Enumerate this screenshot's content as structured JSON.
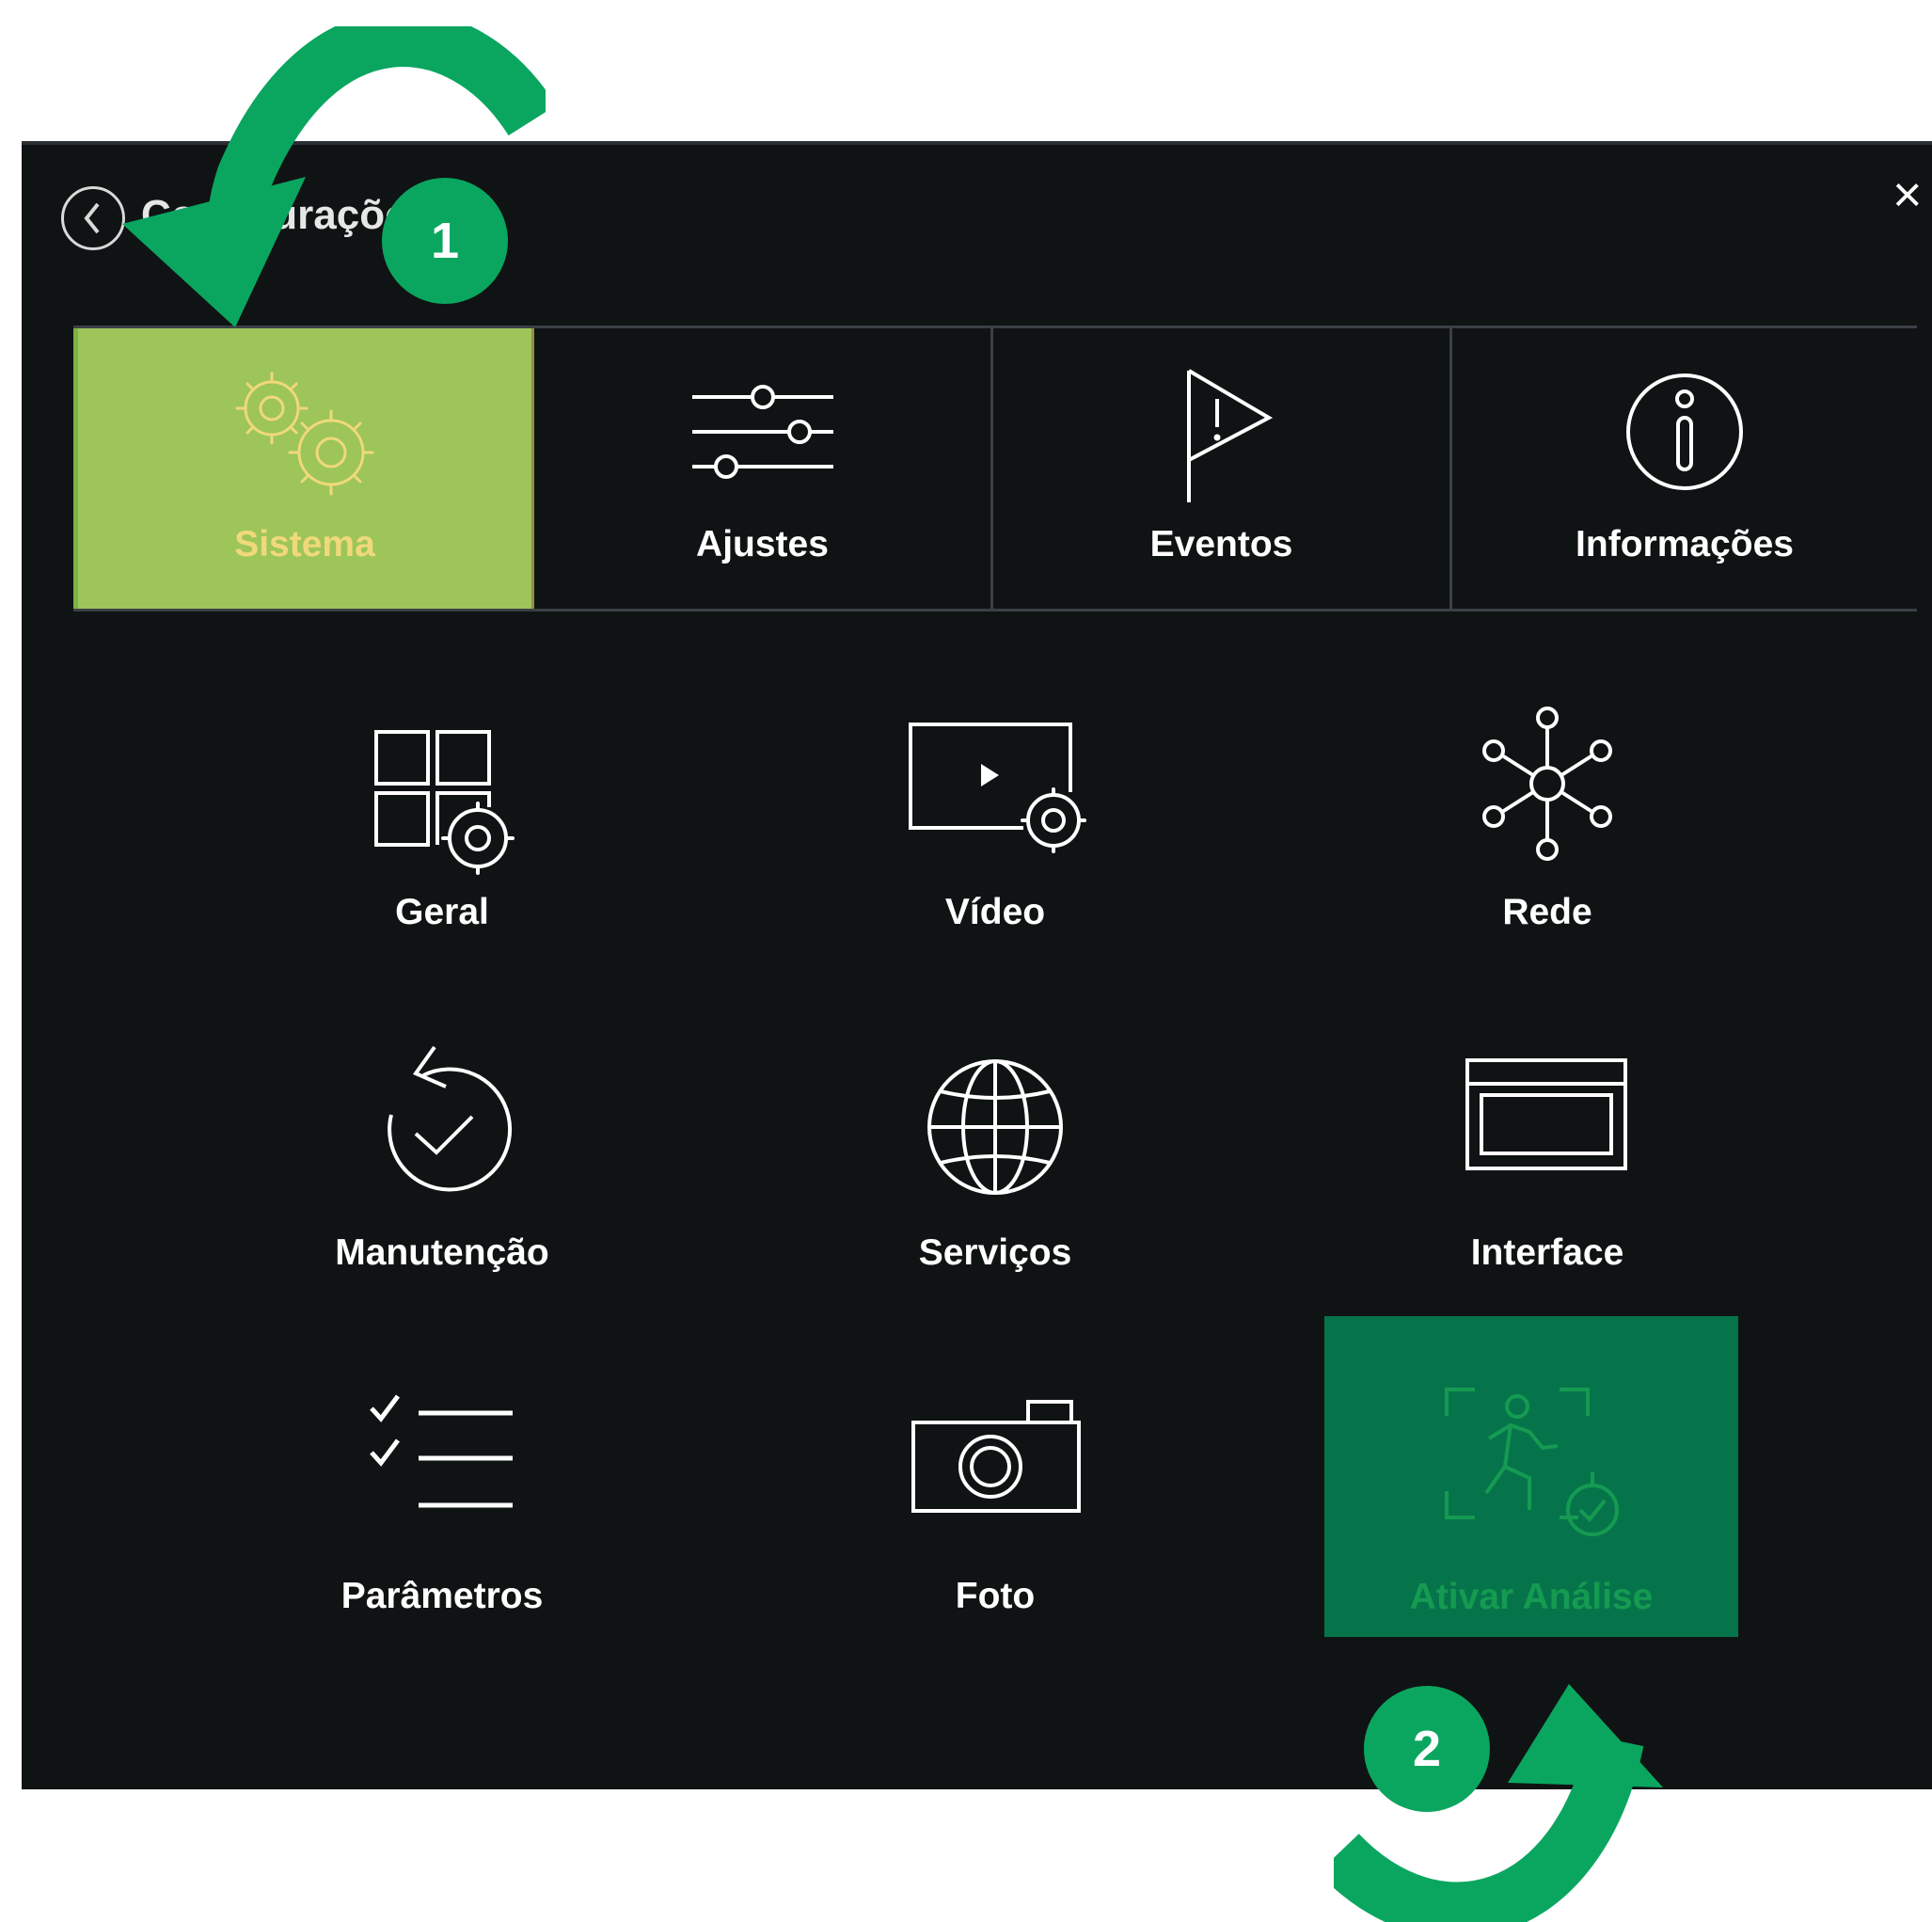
{
  "window": {
    "title": "Configurações",
    "close_label": "×"
  },
  "tabs": [
    {
      "label": "Sistema",
      "icon": "gears-icon",
      "active": true
    },
    {
      "label": "Ajustes",
      "icon": "sliders-icon",
      "active": false
    },
    {
      "label": "Eventos",
      "icon": "flag-alert-icon",
      "active": false
    },
    {
      "label": "Informações",
      "icon": "info-icon",
      "active": false
    }
  ],
  "grid": [
    {
      "label": "Geral",
      "icon": "grid-gear-icon"
    },
    {
      "label": "Vídeo",
      "icon": "video-gear-icon"
    },
    {
      "label": "Rede",
      "icon": "network-icon"
    },
    {
      "label": "Manutenção",
      "icon": "restore-check-icon"
    },
    {
      "label": "Serviços",
      "icon": "globe-icon"
    },
    {
      "label": "Interface",
      "icon": "window-icon"
    },
    {
      "label": "Parâmetros",
      "icon": "checklist-icon"
    },
    {
      "label": "Foto",
      "icon": "camera-icon"
    },
    {
      "label": "Ativar Análise",
      "icon": "person-detect-icon",
      "highlighted": true
    }
  ],
  "annotations": {
    "step1": "1",
    "step2": "2",
    "accent_color": "#0aa660",
    "active_tab_color": "#9dc55a",
    "highlight_tile_color": "#06744a"
  }
}
